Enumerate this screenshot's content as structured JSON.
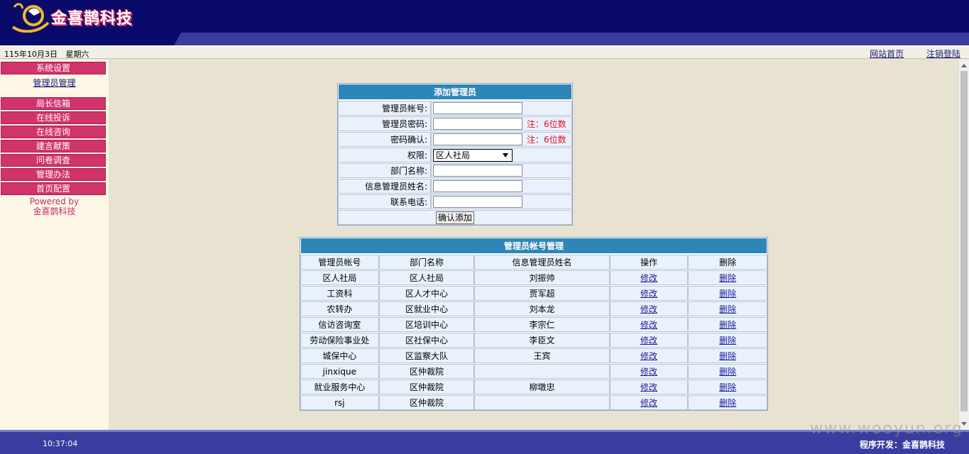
{
  "brand": {
    "name": "金喜鹊科技"
  },
  "infobar": {
    "date": "115年10月3日",
    "weekday": "星期六",
    "links": {
      "home": "网站首页",
      "logout": "注销登陆"
    }
  },
  "sidebar": {
    "items": [
      "系统设置",
      "管理员管理",
      "局长信箱",
      "在线投诉",
      "在线咨询",
      "建言献策",
      "问卷调查",
      "管理办法",
      "首页配置"
    ],
    "powered_by": "Powered by",
    "powered_name": "金喜鹊科技"
  },
  "add_form": {
    "title": "添加管理员",
    "labels": {
      "account": "管理员帐号:",
      "password": "管理员密码:",
      "confirm": "密码确认:",
      "role": "权限:",
      "dept": "部门名称:",
      "info_admin": "信息管理员姓名:",
      "phone": "联系电话:"
    },
    "notes": {
      "password": "注：6位数",
      "confirm": "注：6位数"
    },
    "role_selected": "区人社局",
    "submit": "确认添加"
  },
  "account_table": {
    "title": "管理员帐号管理",
    "headers": [
      "管理员帐号",
      "部门名称",
      "信息管理员姓名",
      "操作",
      "删除"
    ],
    "edit_label": "修改",
    "delete_label": "删除",
    "rows": [
      [
        "区人社局",
        "区人社局",
        "刘振帅"
      ],
      [
        "工资科",
        "区人才中心",
        "贾军超"
      ],
      [
        "农转办",
        "区就业中心",
        "刘本龙"
      ],
      [
        "信访咨询室",
        "区培训中心",
        "李宗仁"
      ],
      [
        "劳动保险事业处",
        "区社保中心",
        "李臣文"
      ],
      [
        "城保中心",
        "区监察大队",
        "王宾"
      ],
      [
        "jinxique",
        "区仲裁院",
        ""
      ],
      [
        "就业服务中心",
        "区仲裁院",
        "柳墩忠"
      ],
      [
        "rsj",
        "区仲裁院",
        ""
      ]
    ]
  },
  "footer": {
    "time": "10:37:04",
    "developer": "程序开发：金喜鹊科技"
  },
  "watermark": "www.wooyun.org"
}
